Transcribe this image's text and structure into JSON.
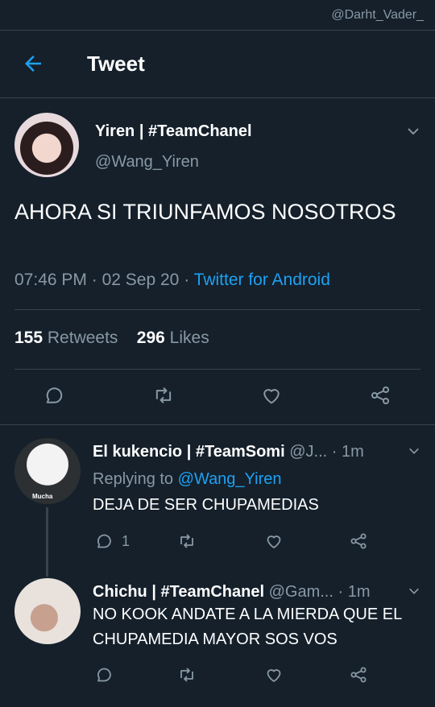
{
  "watermark": "@Darht_Vader_",
  "header": {
    "title": "Tweet"
  },
  "tweet": {
    "name": "Yiren | #TeamChanel",
    "handle": "@Wang_Yiren",
    "text": "AHORA SI TRIUNFAMOS NOSOTROS",
    "time": "07:46 PM",
    "sep1": "·",
    "date": "02 Sep 20",
    "sep2": "·",
    "source": "Twitter for Android",
    "retweets_count": "155",
    "retweets_label": "Retweets",
    "likes_count": "296",
    "likes_label": "Likes"
  },
  "replies": [
    {
      "name": "El kukencio | #TeamSomi",
      "handle": "@J...",
      "sep": "·",
      "time": "1m",
      "replying_prefix": "Replying to",
      "replying_to": "@Wang_Yiren",
      "text": "DEJA DE SER CHUPAMEDIAS",
      "reply_count": "1",
      "avatar_caption": "Mucha"
    },
    {
      "name": "Chichu | #TeamChanel",
      "handle": "@Gam...",
      "sep": "·",
      "time": "1m",
      "text": "NO KOOK ANDATE A LA MIERDA QUE EL CHUPAMEDIA MAYOR SOS VOS",
      "reply_count": ""
    }
  ],
  "colors": {
    "background": "#15202b",
    "accent": "#1da1f2",
    "muted": "#8899a6",
    "border": "#38444d"
  },
  "icons": [
    "back-arrow-icon",
    "chevron-down-icon",
    "reply-icon",
    "retweet-icon",
    "like-icon",
    "share-icon"
  ]
}
